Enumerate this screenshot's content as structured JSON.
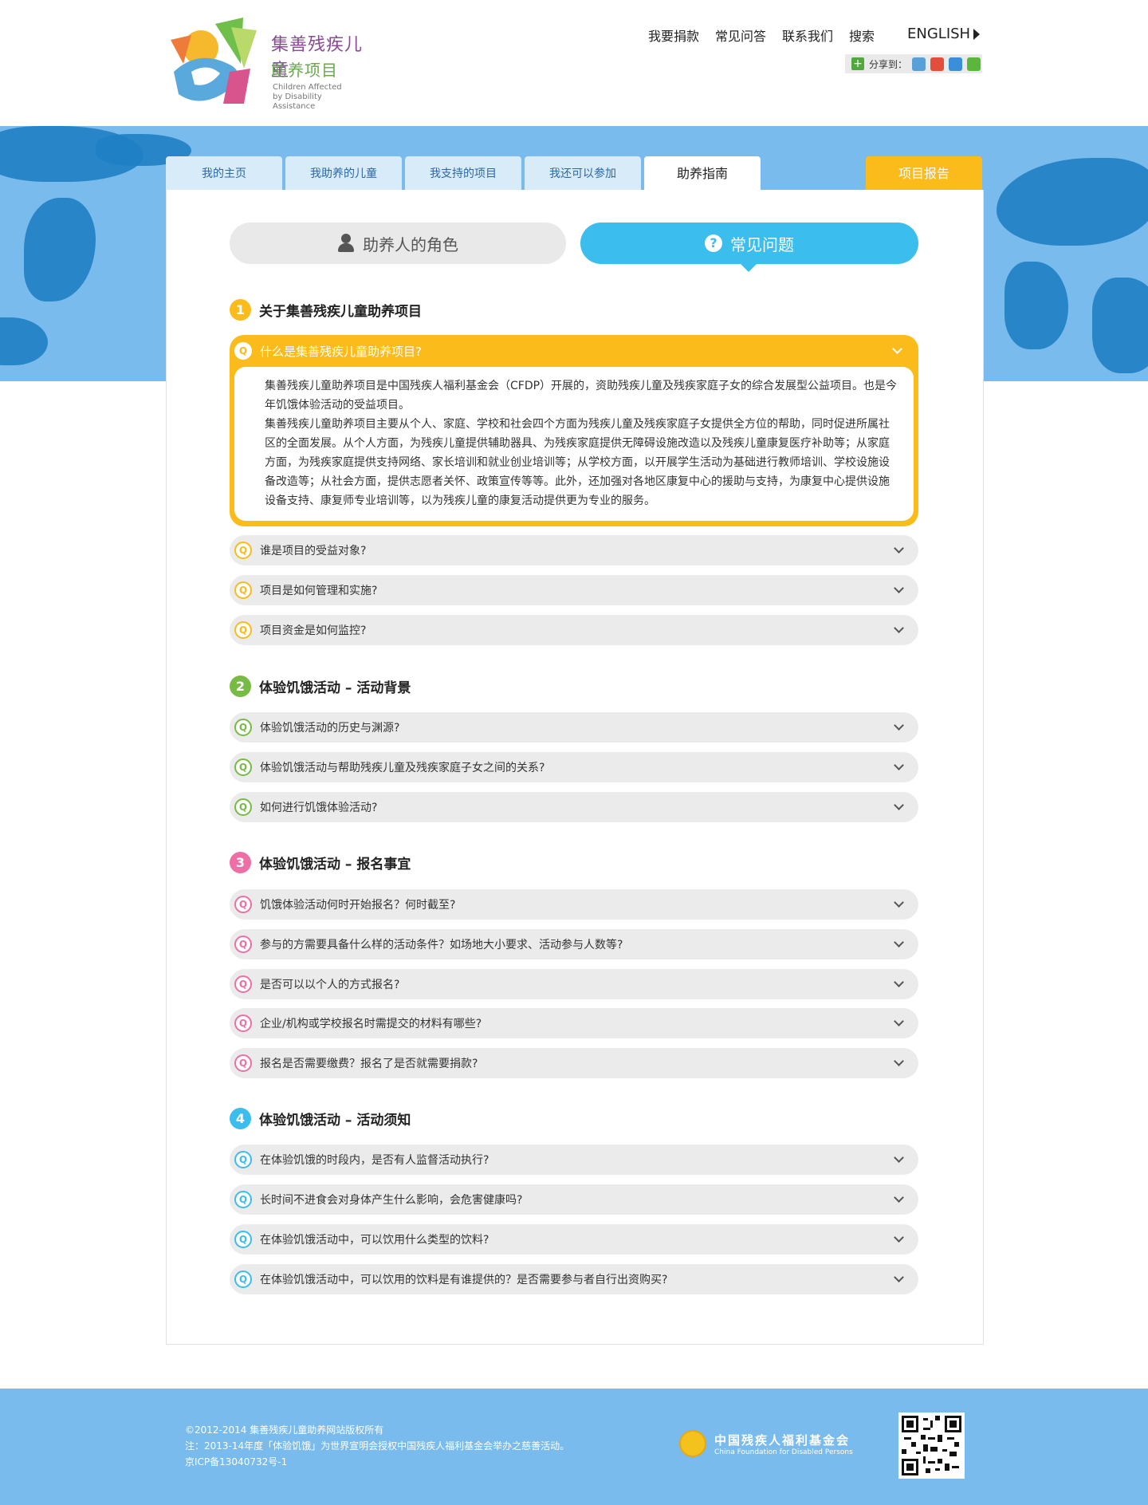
{
  "logo": {
    "cn_line1": "集善残疾儿童",
    "cn_line2": "助养项目",
    "en_line1": "Children Affected",
    "en_line2": "by Disability Assistance"
  },
  "topnav": [
    "我要捐款",
    "常见问答",
    "联系我们",
    "搜索"
  ],
  "lang": "ENGLISH",
  "share_label": "分享到：",
  "tabs": [
    "我的主页",
    "我助养的儿童",
    "我支持的项目",
    "我还可以参加",
    "助养指南"
  ],
  "report_tab": "项目报告",
  "toggle": {
    "role": "助养人的角色",
    "faq": "常见问题"
  },
  "sections": [
    {
      "num": "1",
      "title": "关于集善残疾儿童助养项目",
      "color": "#fbbb1a"
    },
    {
      "num": "2",
      "title": "体验饥饿活动 – 活动背景",
      "color": "#77bb44"
    },
    {
      "num": "3",
      "title": "体验饥饿活动 – 报名事宜",
      "color": "#ee6fa5"
    },
    {
      "num": "4",
      "title": "体验饥饿活动 – 活动须知",
      "color": "#3bbdee"
    }
  ],
  "open_question": {
    "q": "什么是集善残疾儿童助养项目?",
    "p1": "集善残疾儿童助养项目是中国残疾人福利基金会（CFDP）开展的，资助残疾儿童及残疾家庭子女的综合发展型公益项目。也是今年饥饿体验活动的受益项目。",
    "p2": "集善残疾儿童助养项目主要从个人、家庭、学校和社会四个方面为残疾儿童及残疾家庭子女提供全方位的帮助，同时促进所属社区的全面发展。从个人方面，为残疾儿童提供辅助器具、为残疾家庭提供无障碍设施改造以及残疾儿童康复医疗补助等；从家庭方面，为残疾家庭提供支持网络、家长培训和就业创业培训等；从学校方面，以开展学生活动为基础进行教师培训、学校设施设备改造等；从社会方面，提供志愿者关怀、政策宣传等等。此外，还加强对各地区康复中心的援助与支持，为康复中心提供设施设备支持、康复师专业培训等，以为残疾儿童的康复活动提供更为专业的服务。"
  },
  "q_glyph": "Q",
  "questions1": [
    "谁是项目的受益对象?",
    "项目是如何管理和实施?",
    "项目资金是如何监控?"
  ],
  "questions2": [
    "体验饥饿活动的历史与渊源?",
    "体验饥饿活动与帮助残疾儿童及残疾家庭子女之间的关系?",
    "如何进行饥饿体验活动?"
  ],
  "questions3": [
    "饥饿体验活动何时开始报名？何时截至?",
    "参与的方需要具备什么样的活动条件？如场地大小要求、活动参与人数等?",
    "是否可以以个人的方式报名?",
    "企业/机构或学校报名时需提交的材料有哪些?",
    "报名是否需要缴费？报名了是否就需要捐款?"
  ],
  "questions4": [
    "在体验饥饿的时段内，是否有人监督活动执行?",
    "长时间不进食会对身体产生什么影响，会危害健康吗?",
    "在体验饥饿活动中，可以饮用什么类型的饮料?",
    "在体验饥饿活动中，可以饮用的饮料是有谁提供的？是否需要参与者自行出资购买?"
  ],
  "footer": {
    "line1": "©2012-2014 集善残疾儿童助养网站版权所有",
    "line2": "注：2013-14年度「体验饥饿」为世界宣明会授权中国残疾人福利基金会举办之慈善活动。",
    "line3": "京ICP备13040732号-1",
    "org_cn": "中国残疾人福利基金会",
    "org_en": "China Foundation for Disabled Persons"
  }
}
